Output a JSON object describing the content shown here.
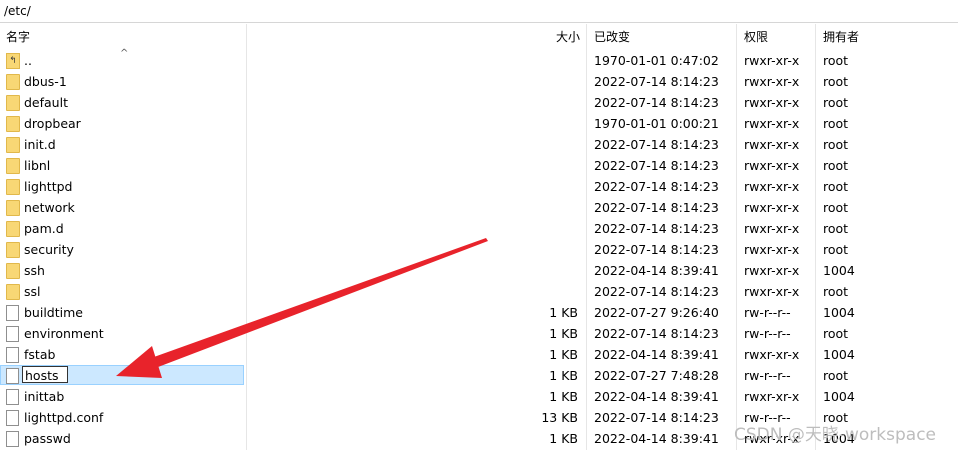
{
  "path": "/etc/",
  "columns": {
    "name": "名字",
    "size": "大小",
    "modified": "已改变",
    "perms": "权限",
    "owner": "拥有者"
  },
  "rows": [
    {
      "name": "..",
      "size": "",
      "modified": "1970-01-01 0:47:02",
      "perms": "rwxr-xr-x",
      "owner": "root",
      "kind": "up"
    },
    {
      "name": "dbus-1",
      "size": "",
      "modified": "2022-07-14 8:14:23",
      "perms": "rwxr-xr-x",
      "owner": "root",
      "kind": "folder"
    },
    {
      "name": "default",
      "size": "",
      "modified": "2022-07-14 8:14:23",
      "perms": "rwxr-xr-x",
      "owner": "root",
      "kind": "folder"
    },
    {
      "name": "dropbear",
      "size": "",
      "modified": "1970-01-01 0:00:21",
      "perms": "rwxr-xr-x",
      "owner": "root",
      "kind": "folder"
    },
    {
      "name": "init.d",
      "size": "",
      "modified": "2022-07-14 8:14:23",
      "perms": "rwxr-xr-x",
      "owner": "root",
      "kind": "folder"
    },
    {
      "name": "libnl",
      "size": "",
      "modified": "2022-07-14 8:14:23",
      "perms": "rwxr-xr-x",
      "owner": "root",
      "kind": "folder"
    },
    {
      "name": "lighttpd",
      "size": "",
      "modified": "2022-07-14 8:14:23",
      "perms": "rwxr-xr-x",
      "owner": "root",
      "kind": "folder"
    },
    {
      "name": "network",
      "size": "",
      "modified": "2022-07-14 8:14:23",
      "perms": "rwxr-xr-x",
      "owner": "root",
      "kind": "folder"
    },
    {
      "name": "pam.d",
      "size": "",
      "modified": "2022-07-14 8:14:23",
      "perms": "rwxr-xr-x",
      "owner": "root",
      "kind": "folder"
    },
    {
      "name": "security",
      "size": "",
      "modified": "2022-07-14 8:14:23",
      "perms": "rwxr-xr-x",
      "owner": "root",
      "kind": "folder"
    },
    {
      "name": "ssh",
      "size": "",
      "modified": "2022-04-14 8:39:41",
      "perms": "rwxr-xr-x",
      "owner": "1004",
      "kind": "folder"
    },
    {
      "name": "ssl",
      "size": "",
      "modified": "2022-07-14 8:14:23",
      "perms": "rwxr-xr-x",
      "owner": "root",
      "kind": "folder"
    },
    {
      "name": "buildtime",
      "size": "1 KB",
      "modified": "2022-07-27 9:26:40",
      "perms": "rw-r--r--",
      "owner": "1004",
      "kind": "file"
    },
    {
      "name": "environment",
      "size": "1 KB",
      "modified": "2022-07-14 8:14:23",
      "perms": "rw-r--r--",
      "owner": "root",
      "kind": "file"
    },
    {
      "name": "fstab",
      "size": "1 KB",
      "modified": "2022-04-14 8:39:41",
      "perms": "rwxr-xr-x",
      "owner": "1004",
      "kind": "file"
    },
    {
      "name": "hosts",
      "size": "1 KB",
      "modified": "2022-07-27 7:48:28",
      "perms": "rw-r--r--",
      "owner": "root",
      "kind": "file",
      "selected": true
    },
    {
      "name": "inittab",
      "size": "1 KB",
      "modified": "2022-04-14 8:39:41",
      "perms": "rwxr-xr-x",
      "owner": "1004",
      "kind": "file"
    },
    {
      "name": "lighttpd.conf",
      "size": "13 KB",
      "modified": "2022-07-14 8:14:23",
      "perms": "rw-r--r--",
      "owner": "root",
      "kind": "file"
    },
    {
      "name": "passwd",
      "size": "1 KB",
      "modified": "2022-04-14 8:39:41",
      "perms": "rwxr-xr-x",
      "owner": "1004",
      "kind": "file"
    }
  ],
  "watermark": "CSDN @天晓-workspace",
  "colors": {
    "selection": "#cce8ff",
    "arrow": "#e8232b",
    "folder": "#f8d775"
  }
}
